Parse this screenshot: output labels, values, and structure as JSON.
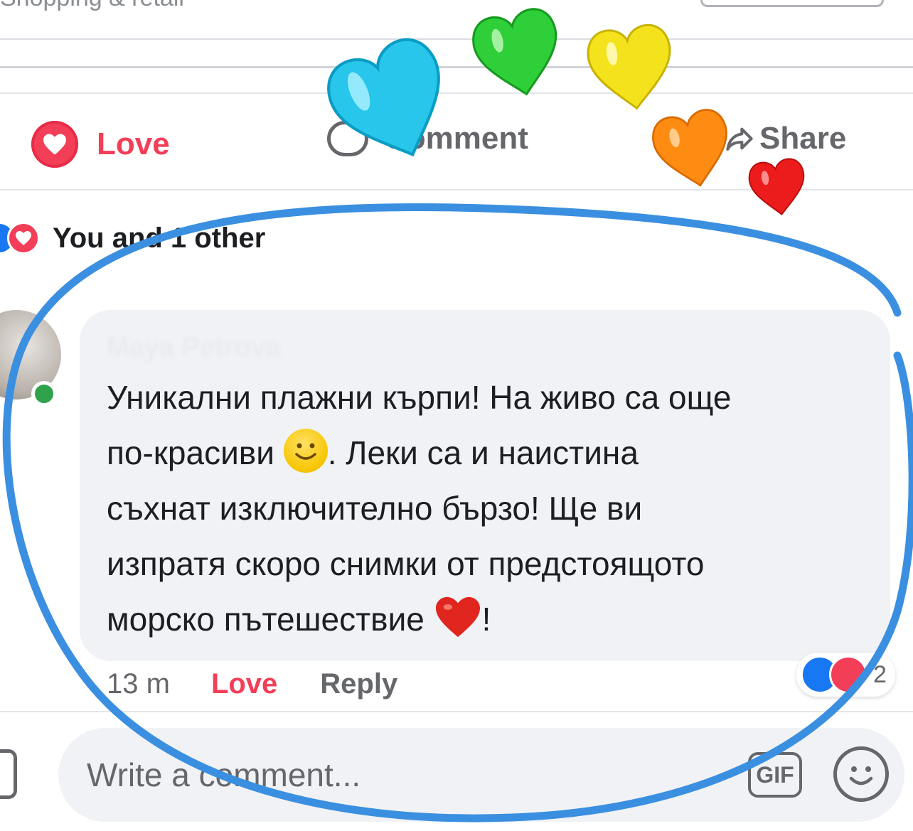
{
  "header": {
    "category": "Shopping & retail"
  },
  "action_bar": {
    "love_label": "Love",
    "comment_label": "Comment",
    "share_label": "Share"
  },
  "reactions_summary": {
    "text": "You and 1 other"
  },
  "comment": {
    "author": "Maya Petrova",
    "lines": [
      "Уникални плажни кърпи! На живо са още",
      "по-красиви",
      ". Леки са и наистина",
      "съхнат изключително бързо! Ще ви",
      "изпратя скоро снимки от предстоящото",
      "морско пътешествие",
      "!"
    ],
    "time": "13 m",
    "love_label": "Love",
    "reply_label": "Reply",
    "reaction_count": "2"
  },
  "composer": {
    "placeholder": "Write a comment...",
    "gif_label": "GIF"
  },
  "colors": {
    "love_red": "#f33e58",
    "like_blue": "#1877f2",
    "online_green": "#31a24c",
    "annotation_circle": "#3b8fe0"
  },
  "icons": [
    "love-reaction-icon",
    "comment-icon",
    "share-icon",
    "like-reaction-icon",
    "camera-icon",
    "gif-icon",
    "emoji-icon",
    "smile-emoji-icon",
    "heart-emoji-icon"
  ]
}
